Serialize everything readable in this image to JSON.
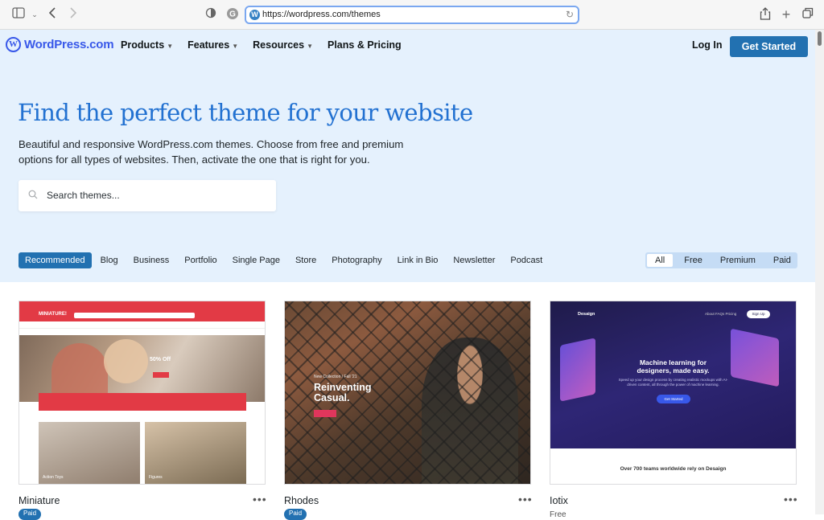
{
  "browser": {
    "url": "https://wordpress.com/themes"
  },
  "nav": {
    "logo": "WordPress.com",
    "menu": [
      "Products",
      "Features",
      "Resources",
      "Plans & Pricing"
    ],
    "login": "Log In",
    "cta": "Get Started"
  },
  "hero": {
    "title": "Find the perfect theme for your website",
    "subtitle": "Beautiful and responsive WordPress.com themes. Choose from free and premium options for all types of websites. Then, activate the one that is right for you.",
    "search_placeholder": "Search themes..."
  },
  "categories": [
    "Recommended",
    "Blog",
    "Business",
    "Portfolio",
    "Single Page",
    "Store",
    "Photography",
    "Link in Bio",
    "Newsletter",
    "Podcast"
  ],
  "pricing_filter": [
    "All",
    "Free",
    "Premium",
    "Paid"
  ],
  "themes": [
    {
      "name": "Miniature",
      "badge": "Paid",
      "preview": {
        "logo": "MINIATURE!",
        "sale": "50% Off",
        "tile1": "Action Toys",
        "tile2": "Figures"
      }
    },
    {
      "name": "Rhodes",
      "badge": "Paid",
      "preview": {
        "kicker": "New Collection / Fall '21",
        "headline1": "Reinventing",
        "headline2": "Casual."
      }
    },
    {
      "name": "Iotix",
      "badge": "Free",
      "preview": {
        "brand": "Desaign",
        "nav": "About   FAQs   Pricing",
        "signup": "Sign Up",
        "headline1": "Machine learning for",
        "headline2": "designers, made easy.",
        "body": "Speed up your design process by creating realistic mockups with AI-driven content, all through the power of machine learning.",
        "button": "Get Started",
        "teams": "Over 700 teams worldwide rely on Desaign"
      }
    }
  ],
  "colors": {
    "accent": "#2271b1",
    "hero_bg": "#e5f1fd",
    "heading": "#2271d1"
  }
}
